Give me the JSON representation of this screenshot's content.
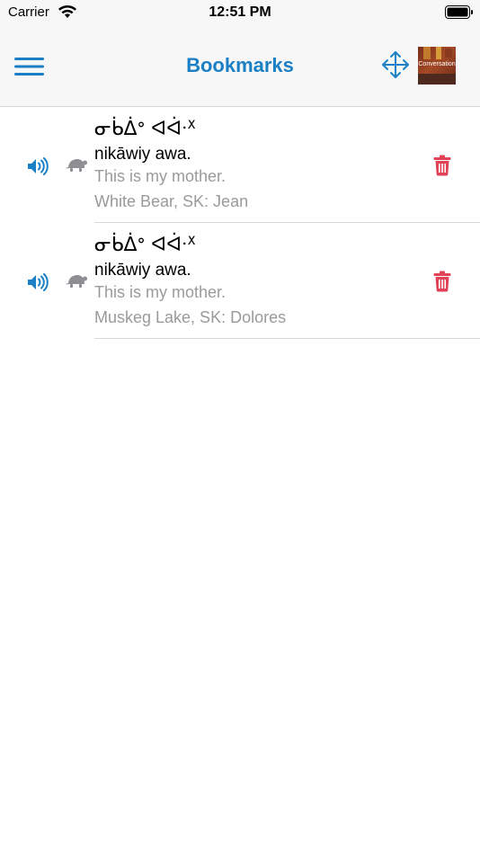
{
  "status_bar": {
    "carrier": "Carrier",
    "time": "12:51 PM"
  },
  "nav": {
    "title": "Bookmarks",
    "menu_icon": "hamburger-menu-icon",
    "move_icon": "move-arrows-icon",
    "book_thumbnail_text": "Conversation"
  },
  "colors": {
    "accent": "#1a7fc4",
    "delete": "#e04358",
    "secondary_text": "#9a9a9a",
    "turtle_icon": "#8e8e93"
  },
  "bookmarks": [
    {
      "syllabics": "ᓂᑳᐄᐤ ᐊᐋᐧᕽ",
      "roman": "nikāwiy awa.",
      "english": "This is my mother.",
      "speaker": "White Bear, SK: Jean"
    },
    {
      "syllabics": "ᓂᑳᐄᐤ ᐊᐋᐧᕽ",
      "roman": "nikāwiy awa.",
      "english": "This is my mother.",
      "speaker": "Muskeg Lake, SK: Dolores"
    }
  ]
}
